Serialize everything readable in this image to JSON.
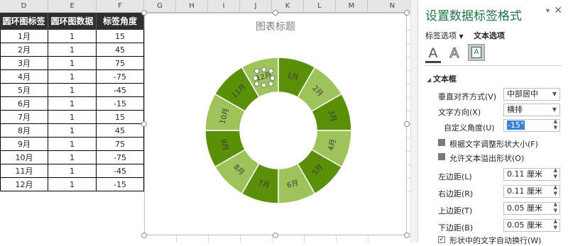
{
  "columns": [
    "D",
    "E",
    "F",
    "G",
    "H",
    "I",
    "J",
    "K",
    "L",
    "M",
    "N"
  ],
  "table": {
    "headers": [
      "圆环图标签",
      "圆环图数据",
      "标签角度"
    ],
    "rows": [
      [
        "1月",
        "1",
        "15"
      ],
      [
        "2月",
        "1",
        "45"
      ],
      [
        "3月",
        "1",
        "75"
      ],
      [
        "4月",
        "1",
        "-75"
      ],
      [
        "5月",
        "1",
        "-45"
      ],
      [
        "6月",
        "1",
        "-15"
      ],
      [
        "7月",
        "1",
        "15"
      ],
      [
        "8月",
        "1",
        "45"
      ],
      [
        "9月",
        "1",
        "75"
      ],
      [
        "10月",
        "1",
        "-75"
      ],
      [
        "11月",
        "1",
        "-45"
      ],
      [
        "12月",
        "1",
        "-15"
      ]
    ]
  },
  "chart": {
    "title": "图表标题"
  },
  "chart_data": {
    "type": "donut",
    "title": "图表标题",
    "categories": [
      "1月",
      "2月",
      "3月",
      "4月",
      "5月",
      "6月",
      "7月",
      "8月",
      "9月",
      "10月",
      "11月",
      "12月"
    ],
    "values": [
      1,
      1,
      1,
      1,
      1,
      1,
      1,
      1,
      1,
      1,
      1,
      1
    ],
    "label_angles": [
      15,
      45,
      75,
      -75,
      -45,
      -15,
      15,
      45,
      75,
      -75,
      -45,
      -15
    ],
    "colors": [
      "#5a8f07",
      "#9dc35a"
    ]
  },
  "pane": {
    "title": "设置数据标签格式",
    "tab_label_options": "标签选项",
    "tab_text_options": "文本选项",
    "section_textbox": "文本框",
    "vertical_align_label": "垂直对齐方式(V)",
    "vertical_align_value": "中部居中",
    "text_direction_label": "文字方向(X)",
    "text_direction_value": "横排",
    "custom_angle_label": "自定义角度(U)",
    "custom_angle_value": "-15°",
    "resize_shape_label": "根据文字调整形状大小(F)",
    "overflow_label": "允许文本溢出形状(O)",
    "left_margin_label": "左边距(L)",
    "left_margin_value": "0.11 厘米",
    "right_margin_label": "右边距(R)",
    "right_margin_value": "0.11 厘米",
    "top_margin_label": "上边距(T)",
    "top_margin_value": "0.05 厘米",
    "bottom_margin_label": "下边距(B)",
    "bottom_margin_value": "0.05 厘米",
    "wrap_label": "形状中的文字自动换行(W)",
    "accent": "#217346"
  }
}
